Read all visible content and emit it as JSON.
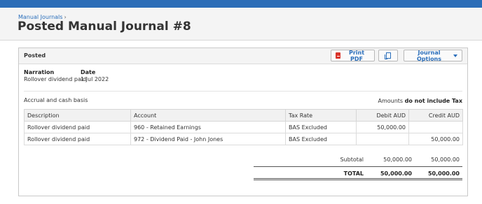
{
  "breadcrumb": {
    "parent": "Manual Journals",
    "separator": "›"
  },
  "page_title": "Posted Manual Journal #8",
  "panel": {
    "status": "Posted",
    "buttons": {
      "print_pdf": "Print PDF",
      "journal_options": "Journal Options"
    },
    "narration_label": "Narration",
    "narration_value": "Rollover dividend paid",
    "date_label": "Date",
    "date_value": "1 Jul 2022",
    "basis": "Accrual and cash basis",
    "amounts_prefix": "Amounts",
    "amounts_note": "do not include Tax"
  },
  "table": {
    "headers": {
      "description": "Description",
      "account": "Account",
      "tax_rate": "Tax Rate",
      "debit": "Debit AUD",
      "credit": "Credit AUD"
    },
    "rows": [
      {
        "description": "Rollover dividend paid",
        "account": "960 - Retained Earnings",
        "tax_rate": "BAS Excluded",
        "debit": "50,000.00",
        "credit": ""
      },
      {
        "description": "Rollover dividend paid",
        "account": "972 - Dividend Paid - John Jones",
        "tax_rate": "BAS Excluded",
        "debit": "",
        "credit": "50,000.00"
      }
    ]
  },
  "totals": {
    "subtotal_label": "Subtotal",
    "subtotal_debit": "50,000.00",
    "subtotal_credit": "50,000.00",
    "total_label": "TOTAL",
    "total_debit": "50,000.00",
    "total_credit": "50,000.00"
  },
  "colors": {
    "topbar": "#2b6db7",
    "link": "#2a6ebb",
    "pdf_icon": "#d9342b"
  }
}
